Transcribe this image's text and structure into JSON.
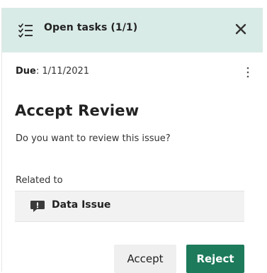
{
  "header": {
    "icon": "task-list-icon",
    "title": "Open tasks (1/1)",
    "close_icon": "close-icon",
    "background": "#d9ebe7"
  },
  "task": {
    "due_label": "Due",
    "due_value": ": 1/11/2021",
    "menu_icon": "more-vertical-icon",
    "title": "Accept Review",
    "description": "Do you want to review this issue?",
    "related_label": "Related to",
    "related_item": {
      "icon": "issue-flag-icon",
      "label": "Data Issue"
    }
  },
  "actions": {
    "accept_label": "Accept",
    "reject_label": "Reject",
    "reject_color": "#1d7a5b"
  }
}
